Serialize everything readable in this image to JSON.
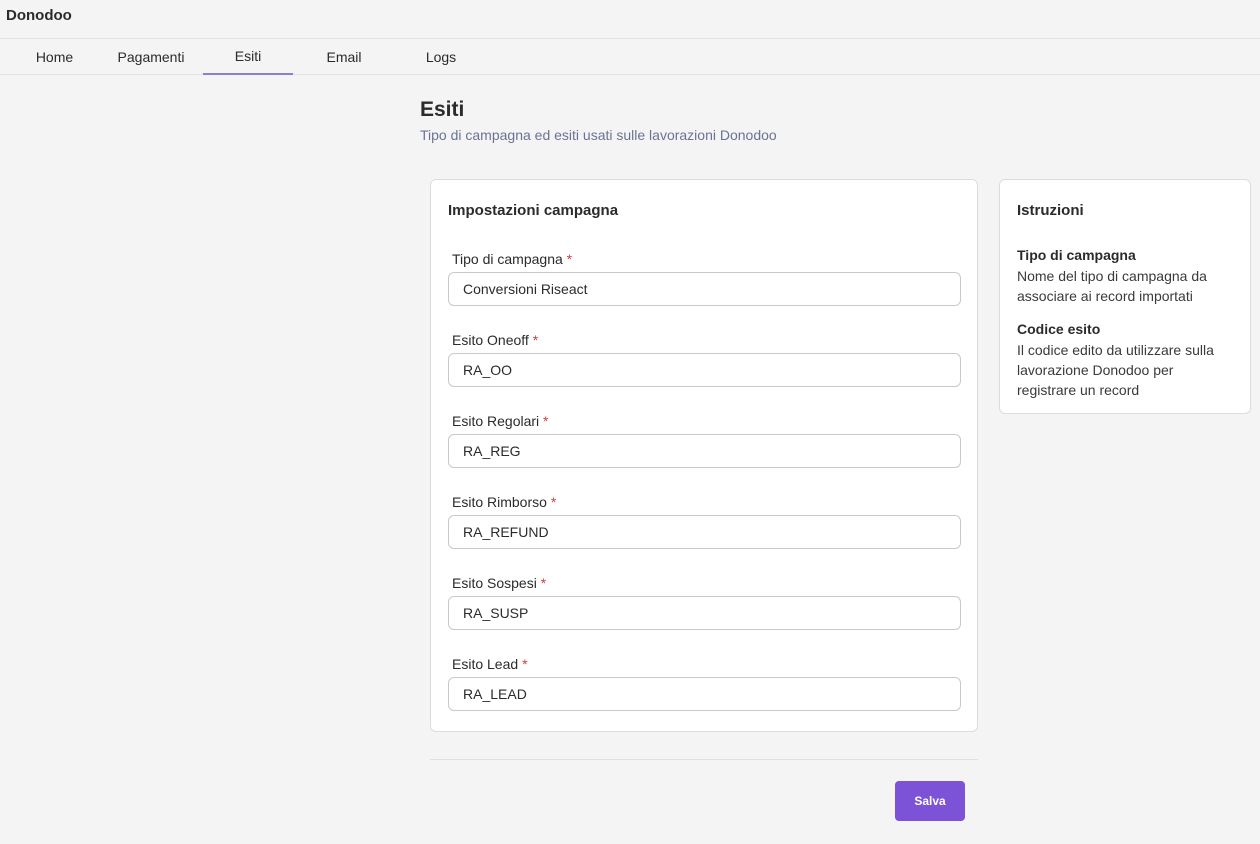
{
  "app": {
    "title": "Donodoo"
  },
  "nav": {
    "tabs": [
      {
        "label": "Home",
        "active": false
      },
      {
        "label": "Pagamenti",
        "active": false
      },
      {
        "label": "Esiti",
        "active": true
      },
      {
        "label": "Email",
        "active": false
      },
      {
        "label": "Logs",
        "active": false
      }
    ]
  },
  "page": {
    "title": "Esiti",
    "subtitle": "Tipo di campagna ed esiti usati sulle lavorazioni Donodoo"
  },
  "settings": {
    "title": "Impostazioni campagna",
    "required_mark": "*",
    "fields": [
      {
        "label": "Tipo di campagna",
        "value": "Conversioni Riseact"
      },
      {
        "label": "Esito Oneoff",
        "value": "RA_OO"
      },
      {
        "label": "Esito Regolari",
        "value": "RA_REG"
      },
      {
        "label": "Esito Rimborso",
        "value": "RA_REFUND"
      },
      {
        "label": "Esito Sospesi",
        "value": "RA_SUSP"
      },
      {
        "label": "Esito Lead",
        "value": "RA_LEAD"
      }
    ]
  },
  "instructions": {
    "title": "Istruzioni",
    "items": [
      {
        "heading": "Tipo di campagna",
        "text": "Nome del tipo di campagna da associare ai record importati"
      },
      {
        "heading": "Codice esito",
        "text": "Il codice edito da utilizzare sulla lavorazione Donodoo per registrare un record"
      }
    ]
  },
  "actions": {
    "save_label": "Salva"
  },
  "colors": {
    "accent": "#7c52d6",
    "tab_indicator": "#8a7fd6",
    "required": "#d33c3c",
    "subtitle": "#6b7394"
  }
}
